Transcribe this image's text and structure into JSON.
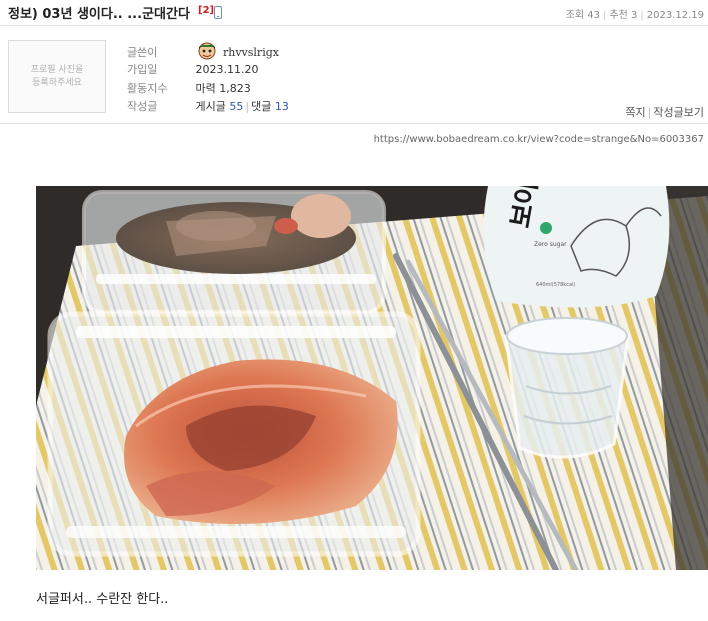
{
  "post": {
    "title": "정보) 03년 생이다.. ...군대간다",
    "comment_count": "[2]",
    "views": "조회 43",
    "recommends": "추천 3",
    "date": "2023.12.19"
  },
  "profile": {
    "photo_placeholder": "프로필 사진을\n등록하주세요",
    "rows": [
      {
        "label": "글쓴이",
        "value": "rhvvslrigx"
      },
      {
        "label": "가입일",
        "value": "2023.11.20"
      },
      {
        "label": "활동지수",
        "value": "마력 1,823"
      },
      {
        "label": "작성글",
        "posts_label": "게시글",
        "posts_count": "55",
        "comments_label": "댓글",
        "comments_count": "13"
      }
    ],
    "links": {
      "message": "쪽지",
      "posts": "작성글보기"
    }
  },
  "url": "https://www.bobaedream.co.kr/view?code=strange&No=6003367",
  "image": {
    "bottle_text": "보야",
    "bottle_small_text": "Zero sugar",
    "bottle_volume": "640ml(578kcal)"
  },
  "caption": "서글퍼서.. 수란잔 한다..",
  "colors": {
    "link_blue": "#2c58b8",
    "badge_red": "#d11c1c"
  }
}
